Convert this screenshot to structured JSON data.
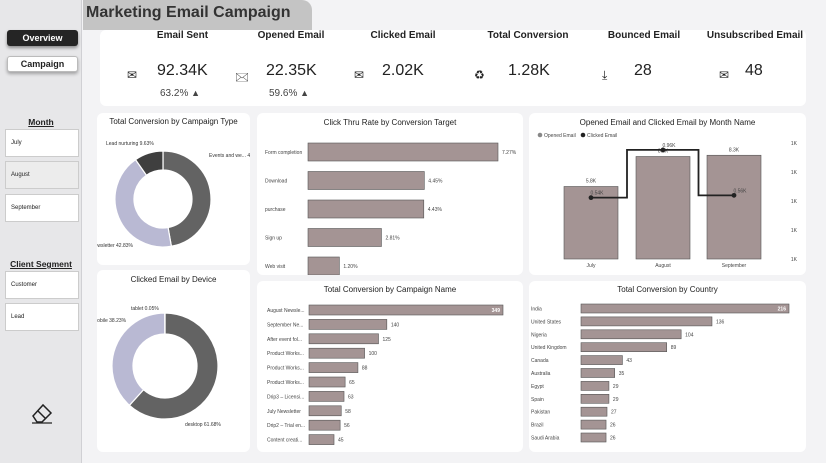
{
  "page_title": "Marketing Email Campaign",
  "nav": {
    "overview": "Overview",
    "campaign": "Campaign"
  },
  "month_slicer": {
    "title": "Month",
    "items": [
      "July",
      "August",
      "September"
    ],
    "selected": "August"
  },
  "segment_slicer": {
    "title": "Client Segment",
    "items": [
      "Customer",
      "Lead"
    ]
  },
  "kpis": [
    {
      "title": "Email Sent",
      "value": "92.34K",
      "pct": "63.2%",
      "icon": "envelope-icon"
    },
    {
      "title": "Opened Email",
      "value": "22.35K",
      "pct": "59.6%",
      "icon": "open-envelope-icon"
    },
    {
      "title": "Clicked Email",
      "value": "2.02K",
      "icon": "click-envelope-icon"
    },
    {
      "title": "Total Conversion",
      "value": "1.28K",
      "icon": "recycle-icon"
    },
    {
      "title": "Bounced Email",
      "value": "28",
      "icon": "bounce-icon"
    },
    {
      "title": "Unsubscribed Email",
      "value": "48",
      "icon": "unsubscribe-icon"
    }
  ],
  "colors": {
    "bar": "#a49494",
    "dark": "#636363",
    "light": "#b9b9d3"
  },
  "chart_data": [
    {
      "id": "conv_campaign_type",
      "type": "pie",
      "title": "Total Conversion by Campaign Type",
      "labels": [
        "Events and we...",
        "Newsletter",
        "Lead nurturing"
      ],
      "values": [
        46.91,
        42.83,
        9.63
      ],
      "label_text": [
        "Events and we... 46.91%",
        "Newsletter 42.83%",
        "Lead nurturing 9.63%"
      ]
    },
    {
      "id": "ctr_target",
      "type": "bar",
      "title": "Click Thru Rate by Conversion Target",
      "categories": [
        "Form completion",
        "Download",
        "purchase",
        "Sign up",
        "Web visit"
      ],
      "values": [
        7.27,
        4.45,
        4.43,
        2.81,
        1.2
      ],
      "value_labels": [
        "7.27%",
        "4.45%",
        "4.43%",
        "2.81%",
        "1.20%"
      ]
    },
    {
      "id": "opened_clicked_month",
      "type": "bar",
      "title": "Opened Email and Clicked Email by Month Name",
      "categories": [
        "July",
        "August",
        "September"
      ],
      "series": [
        {
          "name": "Opened Email",
          "values": [
            5.8,
            8.2,
            8.3
          ],
          "labels": [
            "5.8K",
            "8.2K",
            "8.3K"
          ]
        },
        {
          "name": "Clicked Email",
          "values": [
            0.54,
            0.96,
            0.56
          ],
          "labels": [
            "0.54K",
            "0.96K",
            "0.56K"
          ]
        }
      ],
      "secondary_axis_ticks": [
        "1K",
        "1K",
        "1K",
        "1K",
        "1K"
      ]
    },
    {
      "id": "clicked_device",
      "type": "pie",
      "title": "Clicked Email by Device",
      "labels": [
        "desktop",
        "mobile",
        "tablet"
      ],
      "values": [
        61.68,
        38.23,
        0.05
      ],
      "label_text": [
        "desktop 61.68%",
        "mobile 38.23%",
        "tablet 0.05%"
      ]
    },
    {
      "id": "conv_campaign_name",
      "type": "bar",
      "title": "Total Conversion by Campaign Name",
      "categories": [
        "August Newsle...",
        "September Ne...",
        "After event fol...",
        "Product Works...",
        "Product Works...",
        "Product Works...",
        "Drip3 – Licensi...",
        "July Newsletter",
        "Drip2 – Trial en...",
        "Content creati..."
      ],
      "values": [
        349,
        140,
        125,
        100,
        88,
        65,
        63,
        58,
        56,
        45
      ]
    },
    {
      "id": "conv_country",
      "type": "bar",
      "title": "Total Conversion by Country",
      "categories": [
        "India",
        "United States",
        "Nigeria",
        "United Kingdom",
        "Canada",
        "Australia",
        "Egypt",
        "Spain",
        "Pakistan",
        "Brazil",
        "Saudi Arabia"
      ],
      "values": [
        216,
        136,
        104,
        89,
        43,
        35,
        29,
        29,
        27,
        26,
        26
      ]
    }
  ]
}
